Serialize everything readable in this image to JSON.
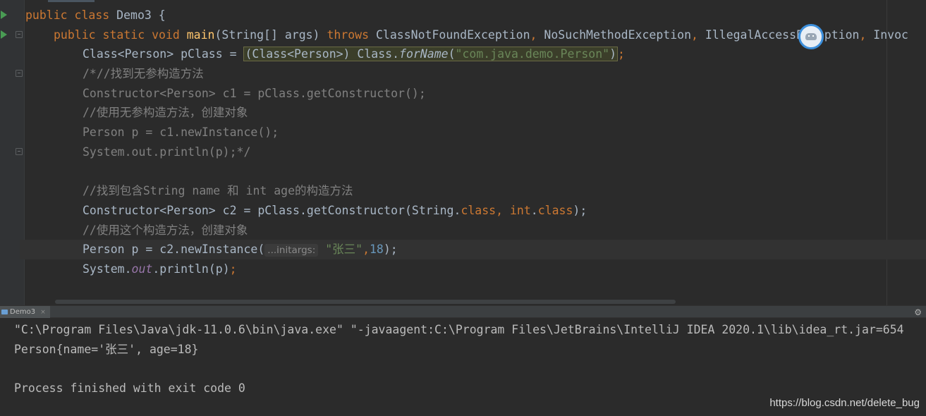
{
  "editor": {
    "lines": [
      {
        "id": "l1",
        "parts": [
          "public class",
          " Demo3 {"
        ]
      },
      {
        "id": "l2",
        "parts": [
          "public static void",
          " main",
          "(String[] args) ",
          "throws",
          " ClassNotFoundException",
          ",",
          " NoSuchMethodException",
          ",",
          " IllegalAccessException",
          ",",
          " Invoc"
        ]
      },
      {
        "id": "l3",
        "parts": [
          "Class<Person> pClass = ",
          "(Class<Person>) Class.",
          "forName",
          "(",
          "\"com.java.demo.Person\"",
          ")",
          ";"
        ]
      },
      {
        "id": "l4",
        "text": "/*//找到无参构造方法"
      },
      {
        "id": "l5",
        "text": "Constructor<Person> c1 = pClass.getConstructor();"
      },
      {
        "id": "l6",
        "text": "//使用无参构造方法，创建对象"
      },
      {
        "id": "l7",
        "text": "Person p = c1.newInstance();"
      },
      {
        "id": "l8",
        "text": "System.out.println(p);*/"
      },
      {
        "id": "l9",
        "text": ""
      },
      {
        "id": "l10",
        "text": "//找到包含String name 和 int age的构造方法"
      },
      {
        "id": "l11",
        "parts": [
          "Constructor<Person> c2 = pClass.getConstructor(String.",
          "class",
          ", ",
          "int",
          ".",
          "class",
          ");"
        ]
      },
      {
        "id": "l12",
        "text": "//使用这个构造方法，创建对象"
      },
      {
        "id": "l13",
        "parts": [
          "Person p = c2.newInstance(",
          "...initargs:",
          " ",
          "\"张三\"",
          ",",
          "18",
          ");"
        ]
      },
      {
        "id": "l14",
        "parts": [
          "System.",
          "out",
          ".println(p)",
          ";"
        ]
      }
    ]
  },
  "run_panel": {
    "tab_label": "Demo3",
    "tab_close": "×",
    "settings_glyph": "⚙",
    "console": [
      "\"C:\\Program Files\\Java\\jdk-11.0.6\\bin\\java.exe\" \"-javaagent:C:\\Program Files\\JetBrains\\IntelliJ IDEA 2020.1\\lib\\idea_rt.jar=654",
      "Person{name='张三', age=18}",
      "",
      "Process finished with exit code 0"
    ]
  },
  "watermark": "https://blog.csdn.net/delete_bug",
  "icons": {
    "run_gutter": "run-arrow-icon",
    "fold": "fold-marker-icon",
    "avatar": "avatar-icon",
    "settings": "gear-icon"
  },
  "colors": {
    "background": "#2b2b2b",
    "keyword": "#cc7832",
    "method": "#ffc66d",
    "string": "#6a8759",
    "number": "#6897bb",
    "comment": "#808080",
    "static_field": "#9876aa",
    "run_icon": "#499c54"
  }
}
